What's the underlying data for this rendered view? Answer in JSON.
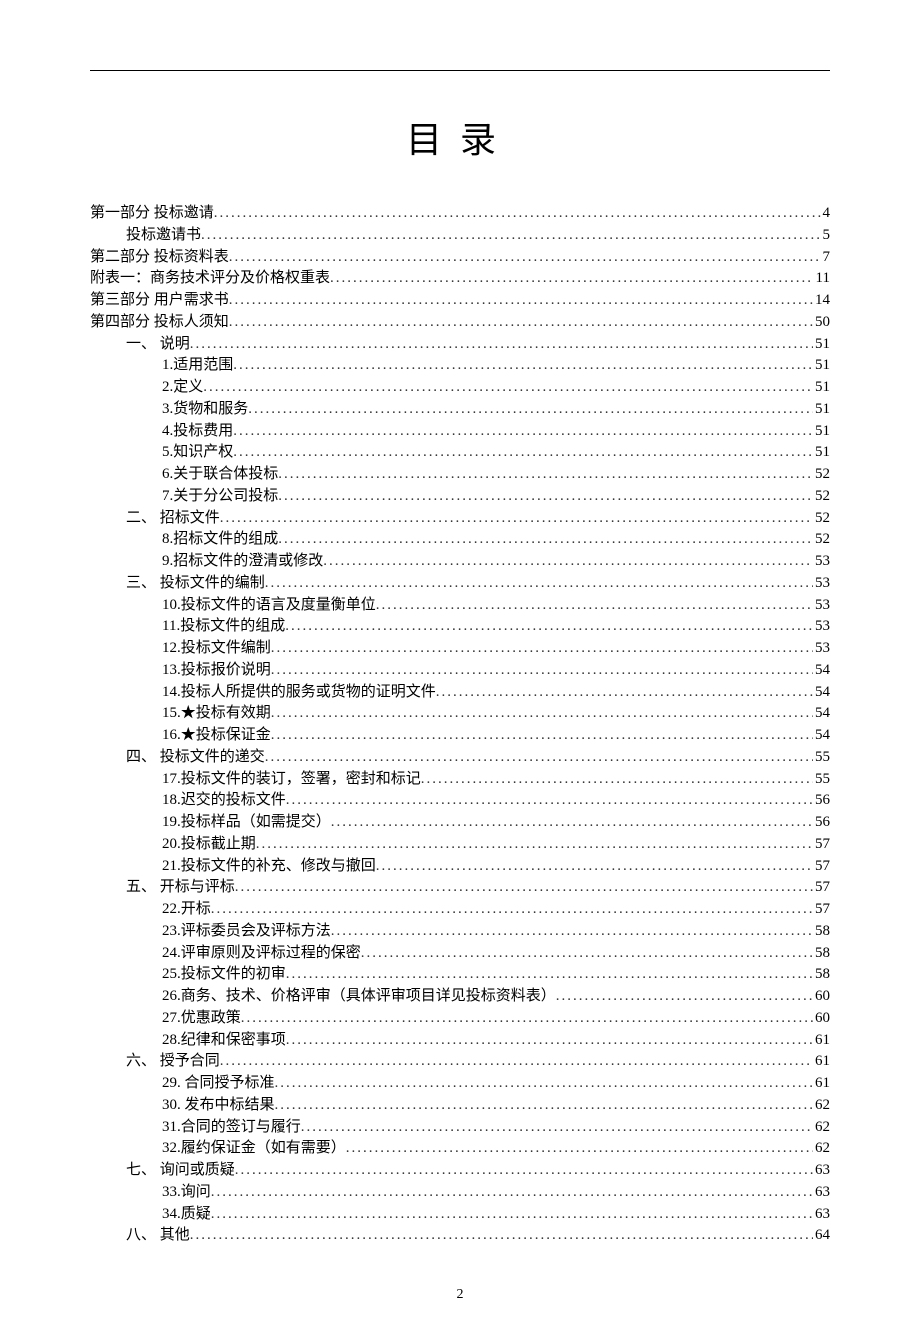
{
  "title": "目录",
  "pageNumber": "2",
  "entries": [
    {
      "level": 0,
      "label": "第一部分 投标邀请",
      "page": "4"
    },
    {
      "level": 1,
      "label": "投标邀请书",
      "page": "5"
    },
    {
      "level": 0,
      "label": "第二部分 投标资料表",
      "page": "7"
    },
    {
      "level": 0,
      "label": "附表一：商务技术评分及价格权重表",
      "page": "11"
    },
    {
      "level": 0,
      "label": "第三部分 用户需求书",
      "page": "14"
    },
    {
      "level": 0,
      "label": "第四部分 投标人须知",
      "page": "50"
    },
    {
      "level": 1,
      "label": "一、 说明",
      "page": "51"
    },
    {
      "level": 2,
      "label": "1.适用范围",
      "page": "51"
    },
    {
      "level": 2,
      "label": "2.定义",
      "page": "51"
    },
    {
      "level": 2,
      "label": "3.货物和服务",
      "page": "51"
    },
    {
      "level": 2,
      "label": "4.投标费用",
      "page": "51"
    },
    {
      "level": 2,
      "label": "5.知识产权",
      "page": "51"
    },
    {
      "level": 2,
      "label": "6.关于联合体投标",
      "page": "52"
    },
    {
      "level": 2,
      "label": "7.关于分公司投标",
      "page": "52"
    },
    {
      "level": 1,
      "label": "二、 招标文件",
      "page": "52"
    },
    {
      "level": 2,
      "label": "8.招标文件的组成",
      "page": "52"
    },
    {
      "level": 2,
      "label": "9.招标文件的澄清或修改",
      "page": "53"
    },
    {
      "level": 1,
      "label": "三、 投标文件的编制",
      "page": "53"
    },
    {
      "level": 2,
      "label": "10.投标文件的语言及度量衡单位",
      "page": "53"
    },
    {
      "level": 2,
      "label": "11.投标文件的组成",
      "page": "53"
    },
    {
      "level": 2,
      "label": "12.投标文件编制",
      "page": "53"
    },
    {
      "level": 2,
      "label": "13.投标报价说明",
      "page": "54"
    },
    {
      "level": 2,
      "label": "14.投标人所提供的服务或货物的证明文件",
      "page": "54"
    },
    {
      "level": 2,
      "label": "15.★投标有效期",
      "page": "54"
    },
    {
      "level": 2,
      "label": "16.★投标保证金",
      "page": "54"
    },
    {
      "level": 1,
      "label": "四、 投标文件的递交",
      "page": "55"
    },
    {
      "level": 2,
      "label": "17.投标文件的装订，签署，密封和标记",
      "page": "55"
    },
    {
      "level": 2,
      "label": "18.迟交的投标文件",
      "page": "56"
    },
    {
      "level": 2,
      "label": "19.投标样品（如需提交）",
      "page": "56"
    },
    {
      "level": 2,
      "label": "20.投标截止期",
      "page": "57"
    },
    {
      "level": 2,
      "label": "21.投标文件的补充、修改与撤回",
      "page": "57"
    },
    {
      "level": 1,
      "label": "五、 开标与评标",
      "page": "57"
    },
    {
      "level": 2,
      "label": "22.开标",
      "page": "57"
    },
    {
      "level": 2,
      "label": "23.评标委员会及评标方法",
      "page": "58"
    },
    {
      "level": 2,
      "label": "24.评审原则及评标过程的保密",
      "page": "58"
    },
    {
      "level": 2,
      "label": "25.投标文件的初审",
      "page": "58"
    },
    {
      "level": 2,
      "label": "26.商务、技术、价格评审（具体评审项目详见投标资料表）",
      "page": "60"
    },
    {
      "level": 2,
      "label": "27.优惠政策",
      "page": "60"
    },
    {
      "level": 2,
      "label": "28.纪律和保密事项",
      "page": "61"
    },
    {
      "level": 1,
      "label": "六、 授予合同",
      "page": "61"
    },
    {
      "level": 2,
      "label": "29. 合同授予标准",
      "page": "61"
    },
    {
      "level": 2,
      "label": "30. 发布中标结果",
      "page": "62"
    },
    {
      "level": 2,
      "label": "31.合同的签订与履行",
      "page": "62"
    },
    {
      "level": 2,
      "label": "32.履约保证金（如有需要）",
      "page": "62"
    },
    {
      "level": 1,
      "label": "七、 询问或质疑",
      "page": "63"
    },
    {
      "level": 2,
      "label": "33.询问",
      "page": "63"
    },
    {
      "level": 2,
      "label": "34.质疑",
      "page": "63"
    },
    {
      "level": 1,
      "label": "八、 其他",
      "page": "64"
    }
  ]
}
